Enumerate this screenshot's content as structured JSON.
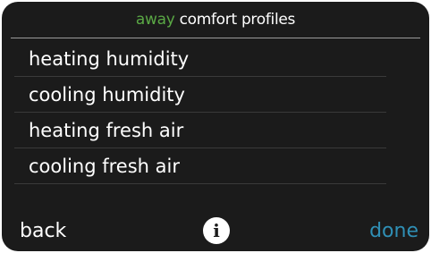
{
  "header": {
    "accent_word": "away",
    "title": "comfort profiles",
    "accent_color": "#5aa845"
  },
  "menu": {
    "items": [
      {
        "label": "heating humidity"
      },
      {
        "label": "cooling humidity"
      },
      {
        "label": "heating fresh air"
      },
      {
        "label": "cooling fresh air"
      }
    ]
  },
  "footer": {
    "back_label": "back",
    "info_icon": "i",
    "done_label": "done",
    "done_color": "#2f8fb5"
  }
}
